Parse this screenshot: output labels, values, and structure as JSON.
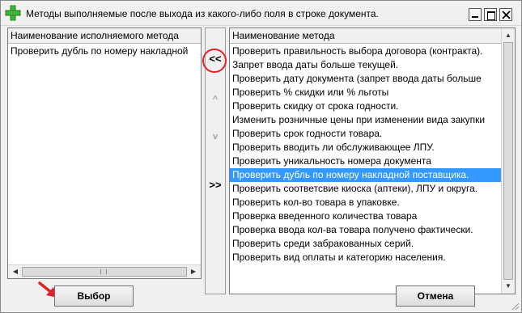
{
  "window": {
    "title": "Методы выполняемые после выхода из какого-либо поля в строке документа.",
    "controls": [
      "minimize",
      "maximize",
      "close"
    ]
  },
  "left_panel": {
    "header": "Наименование исполняемого метода",
    "items": [
      "Проверить дубль по номеру накладной"
    ]
  },
  "toolbar": {
    "add_label": "<<",
    "up_label": "^",
    "down_label": "v",
    "remove_label": ">>"
  },
  "right_panel": {
    "header": "Наименование метода",
    "items": [
      "Проверить правильность выбора договора (контракта).",
      "Запрет ввода даты больше текущей.",
      "Проверить дату документа (запрет ввода даты больше",
      "Проверить % скидки или % льготы",
      "Проверить скидку от срока годности.",
      "Изменить розничные цены при изменении вида закупки",
      "Проверить срок годности товара.",
      "Проверить вводить ли обслуживающее ЛПУ.",
      "Проверить уникальность номера документа",
      "Проверить дубль по номеру накладной поставщика.",
      "Проверить соответсвие киоска (аптеки), ЛПУ  и округа.",
      "Проверить кол-во товара в упаковке.",
      "Проверка введенного количества товара",
      "Проверка ввода кол-ва товара получено фактически.",
      "Проверить среди забракованных серий.",
      "Проверить вид оплаты и категорию населения."
    ],
    "selected_index": 9
  },
  "buttons": {
    "select_label": "Выбор",
    "cancel_label": "Отмена"
  },
  "colors": {
    "selection": "#3399ff",
    "annotation_red": "#e0222a"
  }
}
